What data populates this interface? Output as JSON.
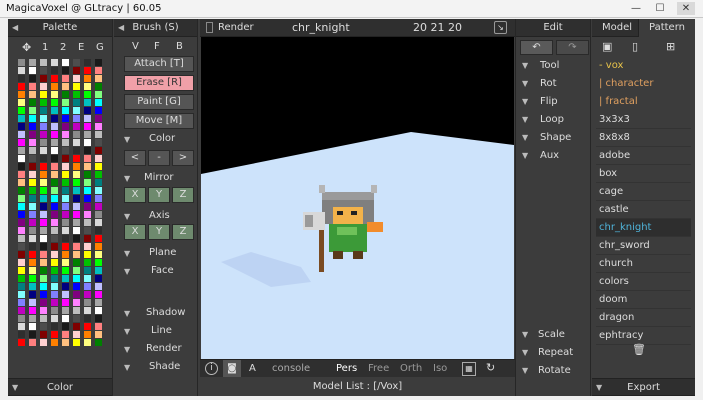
{
  "window": {
    "title": "MagicaVoxel @ GLtracy | 60.05",
    "min": "—",
    "max": "☐",
    "close": "✕"
  },
  "palette": {
    "header": "Palette",
    "tools": [
      "1",
      "2",
      "E",
      "G"
    ],
    "footer": "Color",
    "colors": [
      "#8c8c8c",
      "#a6a6a6",
      "#bdbdbd",
      "#d9d9d9",
      "#ffffff",
      "#4d4d4d",
      "#2e2e2e",
      "#1a1a1a",
      "#7f0000",
      "#ff0000",
      "#ff8080",
      "#ffd0d0",
      "#ff8000",
      "#ffc080",
      "#ffff00",
      "#ffff80",
      "#008000",
      "#00c000",
      "#00ff00",
      "#80ff80",
      "#008080",
      "#00c0c0",
      "#00ffff",
      "#80ffff",
      "#000080",
      "#0000ff",
      "#8080ff",
      "#c0c0ff",
      "#800080",
      "#c000c0",
      "#ff00ff",
      "#ff80ff"
    ]
  },
  "brush": {
    "header": "Brush (S)",
    "modes": [
      "V",
      "F",
      "B"
    ],
    "actions": [
      "Attach [T]",
      "Erase [R]",
      "Paint [G]",
      "Move [M]"
    ],
    "color_label": "Color",
    "color_buttons": [
      "<",
      "-",
      ">"
    ],
    "mirror_label": "Mirror",
    "axis_buttons": [
      "X",
      "Y",
      "Z"
    ],
    "axis_label": "Axis",
    "sections": [
      "Plane",
      "Face",
      "Shadow",
      "Line",
      "Render",
      "Shade"
    ]
  },
  "viewport": {
    "render_tab": "Render",
    "model_name": "chr_knight",
    "dims": "20 21 20",
    "console": "console",
    "views": [
      "Pers",
      "Free",
      "Orth",
      "Iso"
    ],
    "model_list": "Model List : [/Vox]",
    "a_label": "A"
  },
  "edit": {
    "header": "Edit",
    "items": [
      "Tool",
      "Rot",
      "Flip",
      "Loop",
      "Shape",
      "Aux"
    ],
    "bottom": [
      "Scale",
      "Repeat",
      "Rotate"
    ]
  },
  "model": {
    "tabs": [
      "Model",
      "Pattern"
    ],
    "tree": [
      "- vox",
      "| character",
      "| fractal"
    ],
    "files": [
      "3x3x3",
      "8x8x8",
      "adobe",
      "box",
      "cage",
      "castle",
      "chr_knight",
      "chr_sword",
      "church",
      "colors",
      "doom",
      "dragon",
      "ephtracy"
    ],
    "selected": "chr_knight",
    "export": "Export"
  },
  "colors": {
    "accent": "#4fb3d9",
    "tree_text": "#e0a060",
    "vox_text": "#e8c34a",
    "erase_bg": "#f0a0a8",
    "viewport_floor": "#cde3fb"
  }
}
